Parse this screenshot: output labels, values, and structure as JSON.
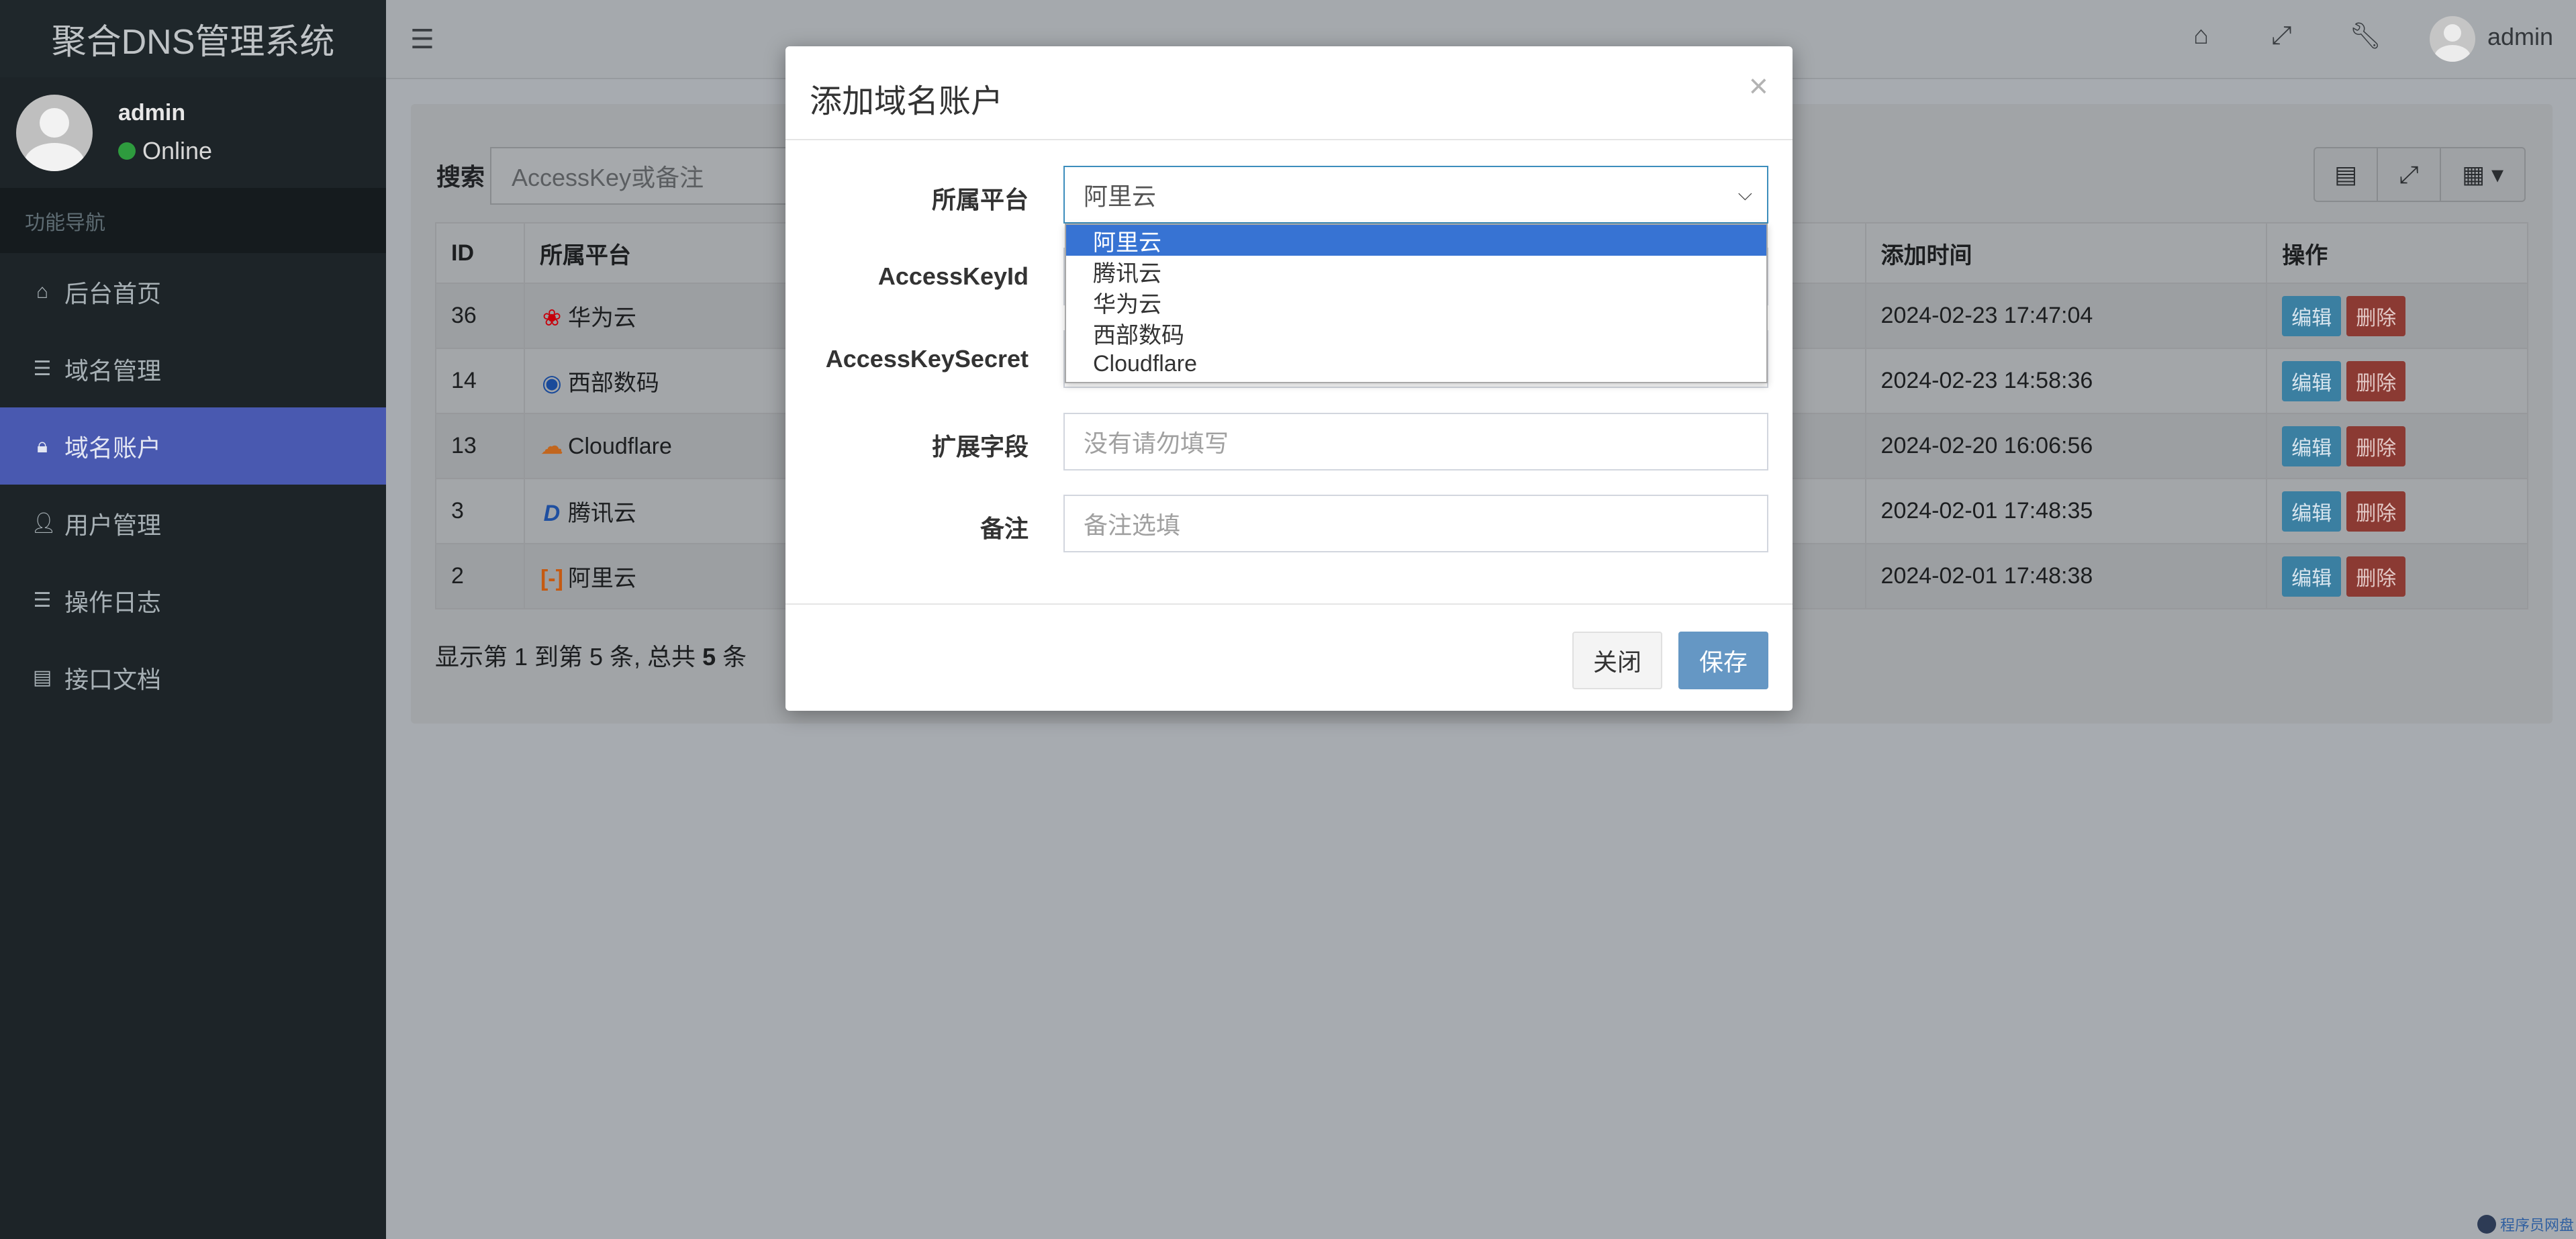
{
  "app": {
    "title": "聚合DNS管理系统"
  },
  "sidebar": {
    "user": {
      "name": "admin",
      "status": "Online"
    },
    "nav_header": "功能导航",
    "items": [
      {
        "label": "后台首页",
        "icon": "home-icon"
      },
      {
        "label": "域名管理",
        "icon": "list-icon"
      },
      {
        "label": "域名账户",
        "icon": "lock-icon",
        "active": true
      },
      {
        "label": "用户管理",
        "icon": "user-icon"
      },
      {
        "label": "操作日志",
        "icon": "list-icon"
      },
      {
        "label": "接口文档",
        "icon": "book-icon"
      }
    ]
  },
  "topbar": {
    "user": "admin"
  },
  "content": {
    "search_label": "搜索",
    "search_placeholder": "AccessKey或备注",
    "table": {
      "headers": [
        "ID",
        "所属平台",
        "添加时间",
        "操作"
      ],
      "rows": [
        {
          "id": "36",
          "platform": "华为云",
          "time": "2024-02-23 17:47:04"
        },
        {
          "id": "14",
          "platform": "西部数码",
          "time": "2024-02-23 14:58:36"
        },
        {
          "id": "13",
          "platform": "Cloudflare",
          "time": "2024-02-20 16:06:56"
        },
        {
          "id": "3",
          "platform": "腾讯云",
          "time": "2024-02-01 17:48:35"
        },
        {
          "id": "2",
          "platform": "阿里云",
          "time": "2024-02-01 17:48:38"
        }
      ],
      "edit_label": "编辑",
      "delete_label": "删除"
    },
    "pager": {
      "prefix": "显示第 1 到第 5 条, 总共 ",
      "total": "5",
      "suffix": " 条"
    }
  },
  "modal": {
    "title": "添加域名账户",
    "close_glyph": "×",
    "fields": {
      "platform_label": "所属平台",
      "platform_value": "阿里云",
      "accesskeyid_label": "AccessKeyId",
      "accesskeysecret_label": "AccessKeySecret",
      "ext_label": "扩展字段",
      "ext_placeholder": "没有请勿填写",
      "remark_label": "备注",
      "remark_placeholder": "备注选填"
    },
    "platform_options": [
      "阿里云",
      "腾讯云",
      "华为云",
      "西部数码",
      "Cloudflare"
    ],
    "close_button": "关闭",
    "save_button": "保存"
  },
  "watermark": "程序员网盘",
  "colors": {
    "sidebar_active": "#4959b0",
    "primary": "#3c8dbc",
    "danger": "#dd4b39",
    "select_highlight": "#3773d3"
  }
}
